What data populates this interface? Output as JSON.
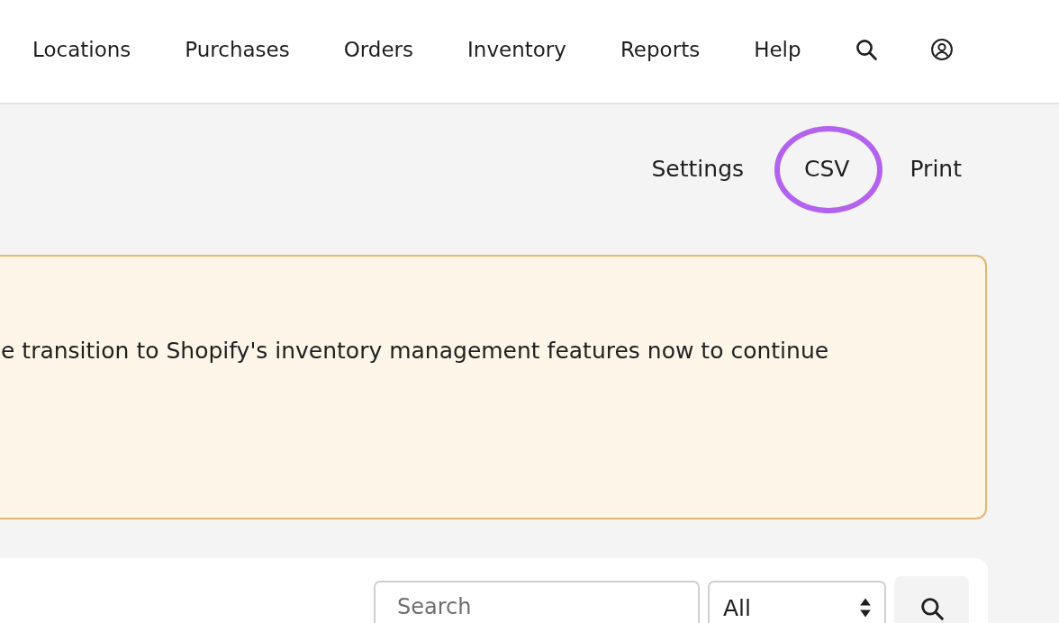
{
  "nav": {
    "items": [
      {
        "label": "Locations"
      },
      {
        "label": "Purchases"
      },
      {
        "label": "Orders"
      },
      {
        "label": "Inventory"
      },
      {
        "label": "Reports"
      },
      {
        "label": "Help"
      }
    ]
  },
  "actions": [
    {
      "label": "Settings",
      "highlighted": false
    },
    {
      "label": "CSV",
      "highlighted": true
    },
    {
      "label": "Print",
      "highlighted": false
    }
  ],
  "banner": {
    "text": "e transition to Shopify's inventory management features now to continue"
  },
  "filters": {
    "search": {
      "placeholder": "Search"
    },
    "select": {
      "value": "All"
    }
  }
}
